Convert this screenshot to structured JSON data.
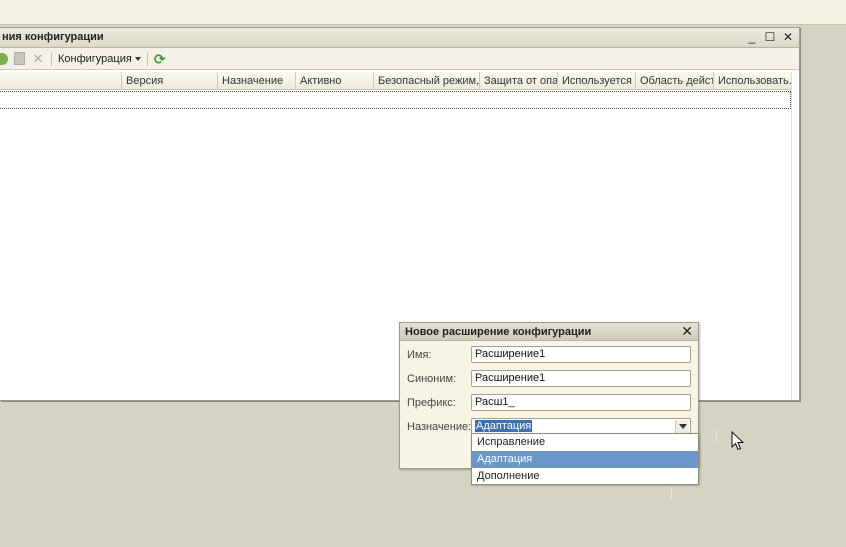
{
  "window": {
    "title": "ния конфигурации",
    "buttons": {
      "minimize": "_",
      "maximize": "☐",
      "close": "✕"
    }
  },
  "toolbar": {
    "config_menu": "Конфигурация"
  },
  "table": {
    "columns": [
      "Версия",
      "Назначение",
      "Активно",
      "Безопасный режим, ...",
      "Защита от опа...",
      "Используется ...",
      "Область дейст...",
      "Использовать..."
    ]
  },
  "dialog": {
    "title": "Новое расширение конфигурации",
    "close": "✕",
    "fields": {
      "name_label": "Имя:",
      "name_value": "Расширение1",
      "synonym_label": "Синоним:",
      "synonym_value": "Расширение1",
      "prefix_label": "Префикс:",
      "prefix_value": "Расш1_",
      "purpose_label": "Назначение:",
      "purpose_value": "Адаптация"
    },
    "options": [
      "Исправление",
      "Адаптация",
      "Дополнение"
    ],
    "selected_option": "Адаптация"
  },
  "colors": {
    "selection": "#6a96c9",
    "desktop": "#d6d3c2"
  }
}
